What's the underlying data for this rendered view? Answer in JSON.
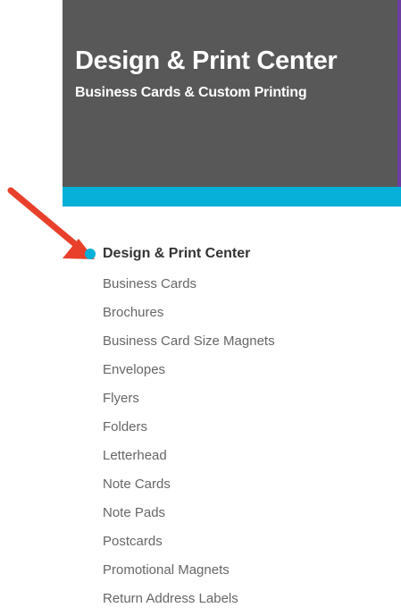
{
  "header": {
    "title": "Design & Print Center",
    "subtitle": "Business Cards & Custom Printing"
  },
  "colors": {
    "header_background": "#585858",
    "accent_stripe": "#06b0d8",
    "accent_edge": "#6b3fa0",
    "arrow": "#e8402a",
    "active_bullet": "#06b0d8"
  },
  "nav": {
    "active_item": "Design & Print Center",
    "items": [
      "Business Cards",
      "Brochures",
      "Business Card Size Magnets",
      "Envelopes",
      "Flyers",
      "Folders",
      "Letterhead",
      "Note Cards",
      "Note Pads",
      "Postcards",
      "Promotional Magnets",
      "Return Address Labels"
    ]
  }
}
